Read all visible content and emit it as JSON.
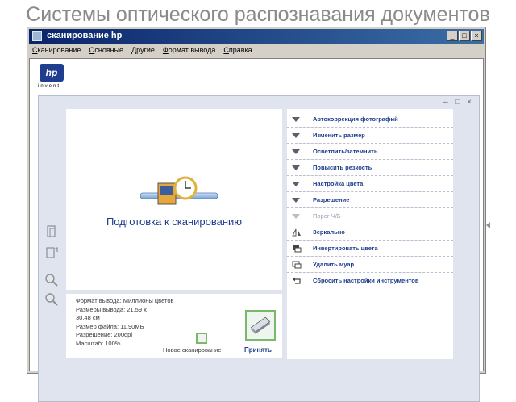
{
  "slide": {
    "title": "Системы оптического распознавания документов"
  },
  "window": {
    "title": "сканирование hp",
    "buttons": {
      "minimize": "_",
      "maximize": "□",
      "close": "×"
    }
  },
  "menu": [
    "Сканирование",
    "Основные",
    "Другие",
    "Формат вывода",
    "Справка"
  ],
  "brand": {
    "logo": "hp",
    "tagline": "invent"
  },
  "panel": {
    "controls": "‒ □ ×"
  },
  "preview": {
    "caption": "Подготовка к сканированию"
  },
  "info": {
    "lines": [
      "Формат вывода: Миллионы цветов",
      "Размеры вывода: 21,59 х",
      "30,48 см",
      "Размер файла: 11,90МБ",
      "Разрешение: 200dpi",
      "Масштаб: 100%"
    ],
    "new_scan_label": "Новое сканирование",
    "accept_label": "Принять"
  },
  "tools": [
    {
      "label": "Автокоррекция фотографий",
      "icon": "triangle-down-icon",
      "disabled": false
    },
    {
      "label": "Изменить размер",
      "icon": "triangle-down-icon",
      "disabled": false
    },
    {
      "label": "Осветлить/затемнить",
      "icon": "triangle-down-icon",
      "disabled": false
    },
    {
      "label": "Повысить резкость",
      "icon": "triangle-down-icon",
      "disabled": false
    },
    {
      "label": "Настройка цвета",
      "icon": "triangle-down-icon",
      "disabled": false
    },
    {
      "label": "Разрешение",
      "icon": "triangle-down-icon",
      "disabled": false
    },
    {
      "label": "Порог Ч/Б",
      "icon": "triangle-down-icon",
      "disabled": true
    },
    {
      "label": "Зеркально",
      "icon": "mirror-icon",
      "disabled": false
    },
    {
      "label": "Инвертировать цвета",
      "icon": "invert-icon",
      "disabled": false
    },
    {
      "label": "Удалить муар",
      "icon": "descreen-icon",
      "disabled": false
    },
    {
      "label": "Сбросить настройки инструментов",
      "icon": "reset-icon",
      "disabled": false
    }
  ],
  "colors": {
    "accent": "#1d3c8b",
    "titlebar": "#0a246a",
    "panel": "#dfe4ef",
    "highlight": "#7ab96b"
  }
}
